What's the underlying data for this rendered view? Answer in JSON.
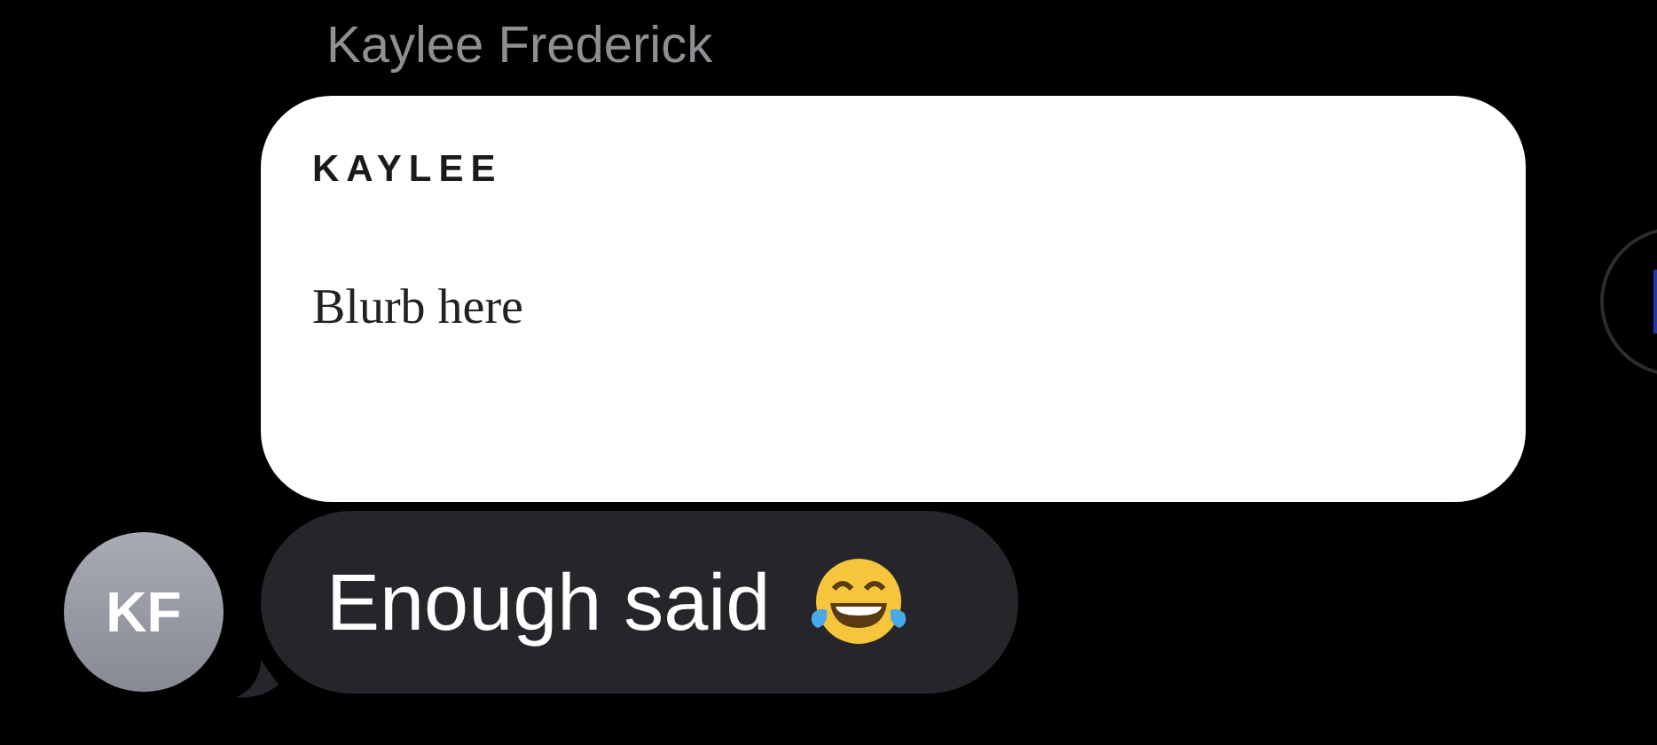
{
  "sender": {
    "name": "Kaylee Frederick"
  },
  "card": {
    "title": "KAYLEE",
    "text": "Blurb here"
  },
  "message": {
    "text": "Enough said"
  },
  "avatar": {
    "initials": "KF"
  }
}
